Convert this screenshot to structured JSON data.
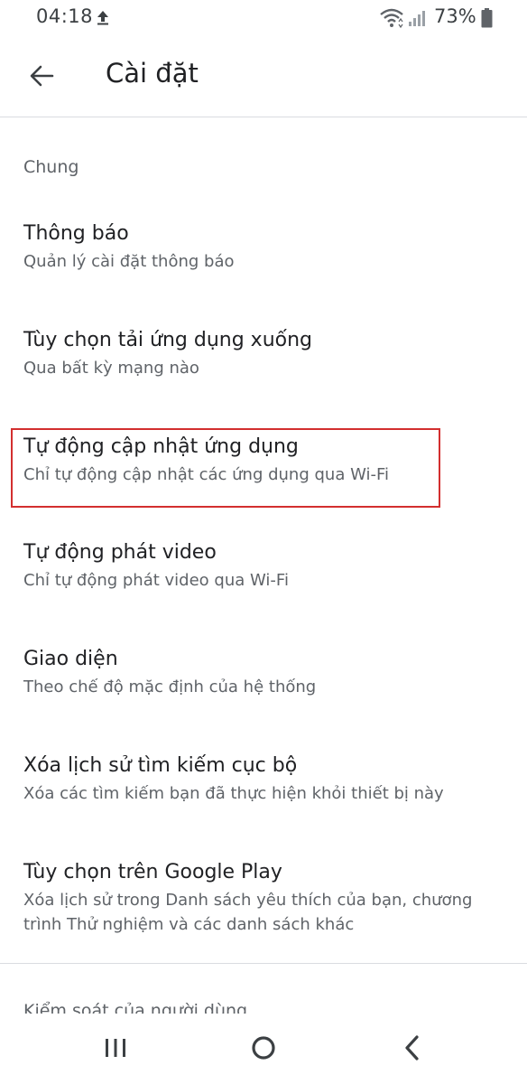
{
  "status_bar": {
    "time": "04:18",
    "battery": "73%"
  },
  "app_bar": {
    "title": "Cài đặt"
  },
  "section": {
    "header": "Chung"
  },
  "settings": [
    {
      "title": "Thông báo",
      "subtitle": "Quản lý cài đặt thông báo"
    },
    {
      "title": "Tùy chọn tải ứng dụng xuống",
      "subtitle": "Qua bất kỳ mạng nào"
    },
    {
      "title": "Tự động cập nhật ứng dụng",
      "subtitle": "Chỉ tự động cập nhật các ứng dụng qua Wi-Fi"
    },
    {
      "title": "Tự động phát video",
      "subtitle": "Chỉ tự động phát video qua Wi-Fi"
    },
    {
      "title": "Giao diện",
      "subtitle": "Theo chế độ mặc định của hệ thống"
    },
    {
      "title": "Xóa lịch sử tìm kiếm cục bộ",
      "subtitle": "Xóa các tìm kiếm bạn đã thực hiện khỏi thiết bị này"
    },
    {
      "title": "Tùy chọn trên Google Play",
      "subtitle": "Xóa lịch sử trong Danh sách yêu thích của bạn, chương trình Thử nghiệm và các danh sách khác"
    }
  ],
  "next_section": {
    "header": "Kiểm soát của người dùng"
  },
  "icons": {
    "status": [
      "upload-icon",
      "wifi-icon",
      "signal-icon",
      "battery-icon"
    ],
    "app_bar": [
      "arrow-back-icon"
    ],
    "nav": [
      "recents-icon",
      "home-icon",
      "back-icon"
    ]
  },
  "colors": {
    "highlight": "#d32f2f",
    "title_text": "#202124",
    "secondary_text": "#5f6368",
    "divider": "#dadce0"
  }
}
